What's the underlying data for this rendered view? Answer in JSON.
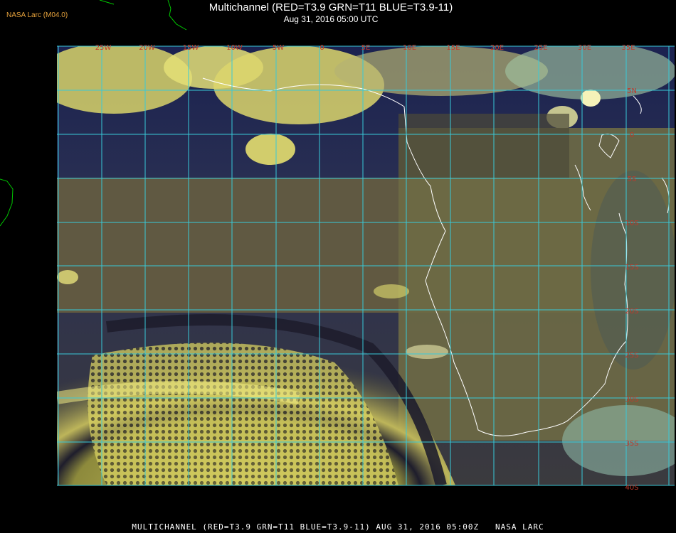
{
  "header": {
    "organization": "NASA Larc (M04.0)",
    "title": "Multichannel (RED=T3.9 GRN=T11 BLUE=T3.9-11)",
    "datetime": "Aug 31, 2016 05:00 UTC"
  },
  "footer": {
    "text": "MULTICHANNEL (RED=T3.9 GRN=T11 BLUE=T3.9-11) AUG 31, 2016 05:00Z   NASA LARC"
  },
  "map": {
    "longitude_labels": [
      "25W",
      "20W",
      "15W",
      "10W",
      "5W",
      "0",
      "5E",
      "10E",
      "15E",
      "20E",
      "25E",
      "30E",
      "35E"
    ],
    "latitude_labels": [
      "5N",
      "0",
      "5S",
      "10S",
      "15S",
      "20S",
      "25S",
      "30S",
      "35S",
      "40S"
    ],
    "colors": {
      "grid": "#38c9d8",
      "coastline": "#ffffff",
      "label": "#c0392b",
      "ocean_dark": "#1c2450",
      "land_brown": "#7a6e45",
      "cloud_yellow": "#e8e27a",
      "coast_outer": "#00c800"
    }
  }
}
